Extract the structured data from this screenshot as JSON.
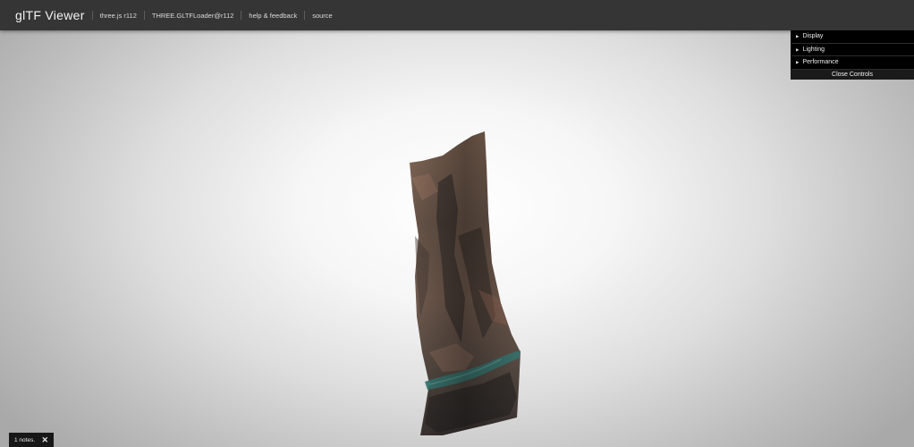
{
  "header": {
    "title": "glTF Viewer",
    "nav": [
      {
        "label": "three.js r112"
      },
      {
        "label": "THREE.GLTFLoader@r112"
      },
      {
        "label": "help & feedback"
      },
      {
        "label": "source"
      }
    ]
  },
  "controls": {
    "folders": [
      {
        "label": "Display"
      },
      {
        "label": "Lighting"
      },
      {
        "label": "Performance"
      }
    ],
    "close_label": "Close Controls"
  },
  "notes": {
    "text": "1 notes.",
    "close_icon": "✕"
  },
  "icons": {
    "caret": "caret-right-icon",
    "close": "close-icon"
  }
}
